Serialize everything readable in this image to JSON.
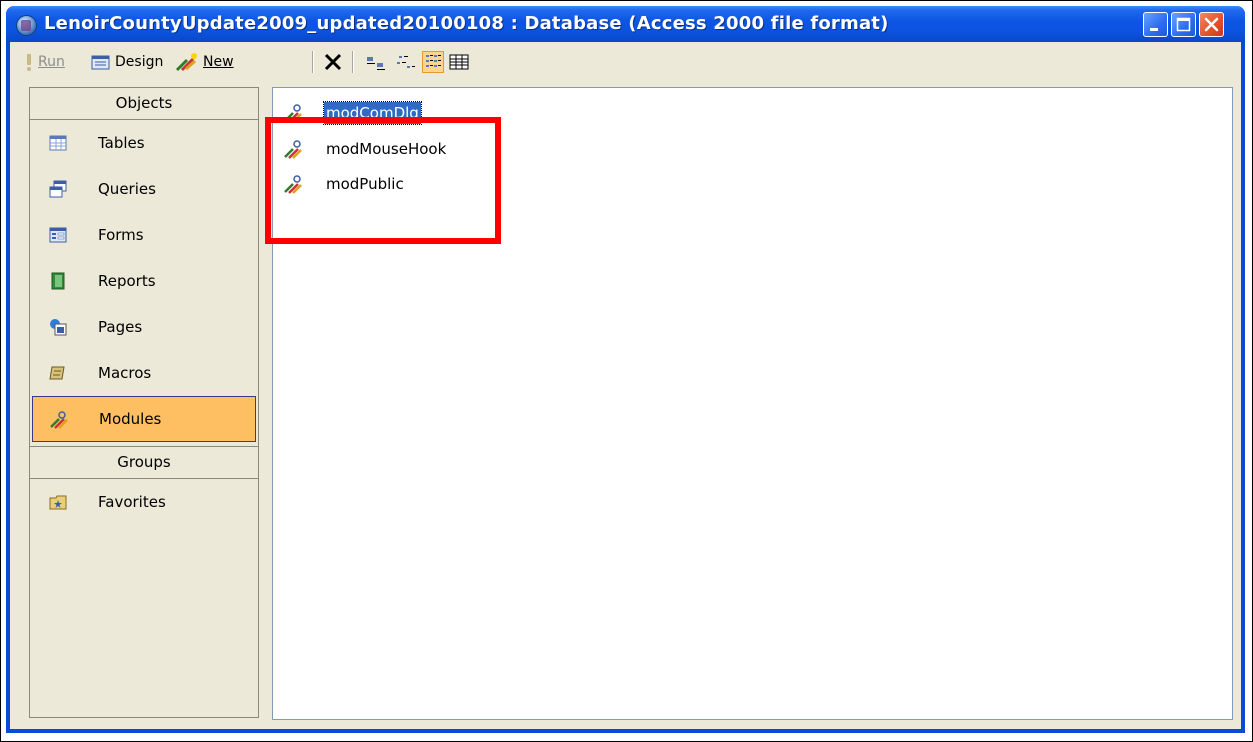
{
  "window": {
    "title": "LenoirCountyUpdate2009_updated20100108 : Database (Access 2000 file format)",
    "controls": [
      "minimize-icon",
      "maximize-icon",
      "close-icon"
    ]
  },
  "toolbar": {
    "run_label": "Run",
    "design_label": "Design",
    "new_label": "New",
    "icons": [
      "run-icon",
      "design-icon",
      "new-module-icon",
      "delete-icon",
      "large-icons-view-icon",
      "small-icons-view-icon",
      "list-view-icon",
      "details-view-icon"
    ]
  },
  "sidebar": {
    "objects_header": "Objects",
    "groups_header": "Groups",
    "items": [
      {
        "label": "Tables",
        "icon": "table-icon"
      },
      {
        "label": "Queries",
        "icon": "query-icon"
      },
      {
        "label": "Forms",
        "icon": "form-icon"
      },
      {
        "label": "Reports",
        "icon": "report-icon"
      },
      {
        "label": "Pages",
        "icon": "page-icon"
      },
      {
        "label": "Macros",
        "icon": "macro-icon"
      },
      {
        "label": "Modules",
        "icon": "module-icon",
        "selected": true
      }
    ],
    "groups": [
      {
        "label": "Favorites",
        "icon": "favorites-folder-icon"
      }
    ]
  },
  "main": {
    "modules": [
      {
        "name": "modComDlg",
        "selected": true
      },
      {
        "name": "modMouseHook"
      },
      {
        "name": "modPublic"
      }
    ]
  },
  "colors": {
    "titlebar": "#0a4bd6",
    "panel": "#ece9d8",
    "selection": "#316ac5",
    "sidebar_selected": "#fdbf62",
    "highlight_box": "#ff0000"
  }
}
